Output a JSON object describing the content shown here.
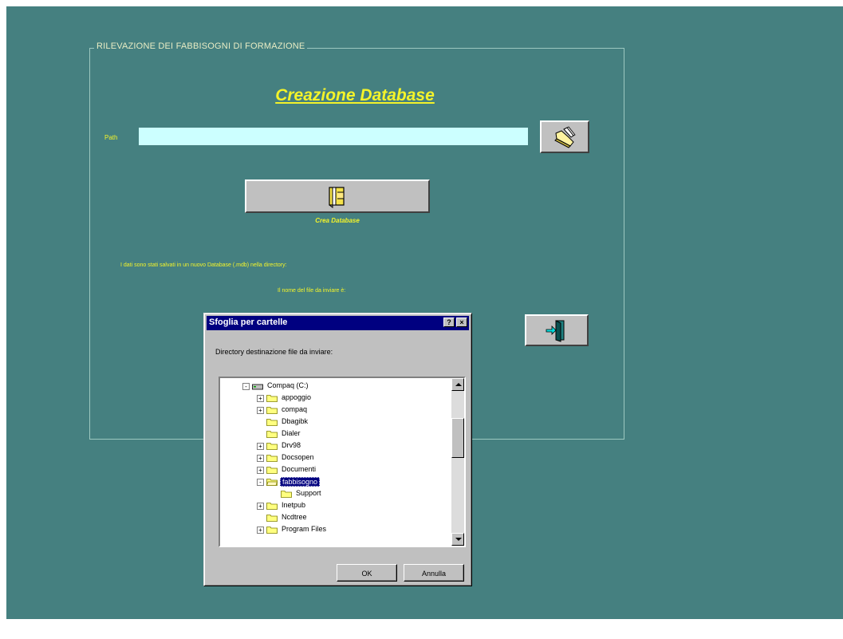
{
  "frame": {
    "legend": "RILEVAZIONE DEI FABBISOGNI DI FORMAZIONE"
  },
  "title": "Creazione Database",
  "path": {
    "label": "Path",
    "value": ""
  },
  "create_button": {
    "label": "Crea Database"
  },
  "info": {
    "line1": "I dati sono stati salvati in un nuovo Database (.mdb) nella directory:",
    "line2": "Il nome del file da inviare è:"
  },
  "icons": {
    "browse": "folder-browse-icon",
    "create": "create-database-icon",
    "exit": "exit-door-icon"
  },
  "colors": {
    "background": "#458080",
    "accent_text": "#f3f32a",
    "input_bg": "#ccffff",
    "titlebar": "#000080"
  },
  "dialog": {
    "title": "Sfoglia per cartelle",
    "help": "?",
    "close": "×",
    "label": "Directory destinazione file da inviare:",
    "tree": [
      {
        "label": "Compaq (C:)",
        "level": 0,
        "expander": "-",
        "icon": "drive"
      },
      {
        "label": "appoggio",
        "level": 1,
        "expander": "+",
        "icon": "folder"
      },
      {
        "label": "compaq",
        "level": 1,
        "expander": "+",
        "icon": "folder"
      },
      {
        "label": "Dbagibk",
        "level": 1,
        "expander": "",
        "icon": "folder"
      },
      {
        "label": "Dialer",
        "level": 1,
        "expander": "",
        "icon": "folder"
      },
      {
        "label": "Drv98",
        "level": 1,
        "expander": "+",
        "icon": "folder"
      },
      {
        "label": "Docsopen",
        "level": 1,
        "expander": "+",
        "icon": "folder"
      },
      {
        "label": "Documenti",
        "level": 1,
        "expander": "+",
        "icon": "folder"
      },
      {
        "label": "fabbisogno",
        "level": 1,
        "expander": "-",
        "icon": "folder-open",
        "selected": true
      },
      {
        "label": "Support",
        "level": 2,
        "expander": "",
        "icon": "folder"
      },
      {
        "label": "Inetpub",
        "level": 1,
        "expander": "+",
        "icon": "folder"
      },
      {
        "label": "Ncdtree",
        "level": 1,
        "expander": "",
        "icon": "folder"
      },
      {
        "label": "Program Files",
        "level": 1,
        "expander": "+",
        "icon": "folder"
      }
    ],
    "ok": "OK",
    "cancel": "Annulla"
  }
}
